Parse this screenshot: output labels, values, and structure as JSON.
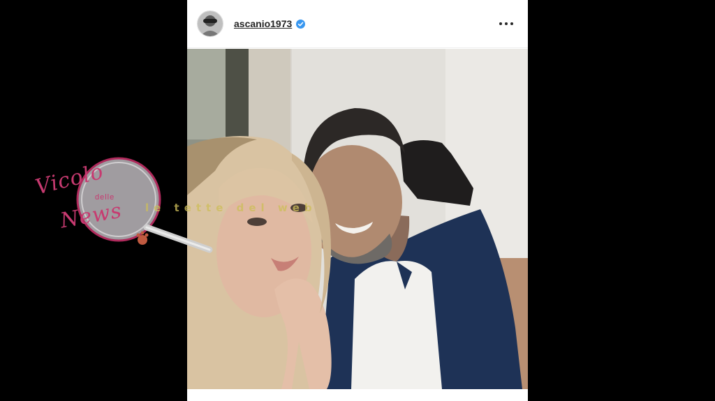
{
  "post": {
    "username": "ascanio1973",
    "verified": true,
    "avatar_icon": "profile-avatar",
    "more_icon": "more-options-icon",
    "photo_alt": "selfie"
  },
  "watermark": {
    "script_line1": "Vicolo",
    "script_small": "delle",
    "script_line2": "News",
    "tagline": "le tette del web"
  },
  "colors": {
    "background": "#000000",
    "post_background": "#ffffff",
    "verified_badge": "#3897f0",
    "username": "#262626",
    "watermark_pink": "#c73a70"
  }
}
